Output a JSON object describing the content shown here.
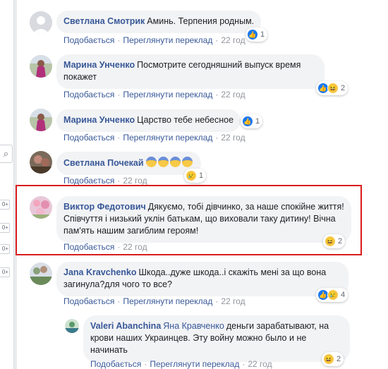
{
  "comments": [
    {
      "author": "Светлана Смотрик",
      "text": "Аминь. Терпения родным.",
      "like": "Подобається",
      "translate": "Переглянути переклад",
      "time": "22 год",
      "reaction_count": "1"
    },
    {
      "author": "Марина Унченко",
      "text": "Посмотрите сегодняшний выпуск время покажет",
      "like": "Подобається",
      "translate": "Переглянути переклад",
      "time": "22 год",
      "reaction_count": "2"
    },
    {
      "author": "Марина Унченко",
      "text": "Царство тебе небесное",
      "like": "Подобається",
      "translate": "Переглянути переклад",
      "time": "22 год",
      "reaction_count": "1"
    },
    {
      "author": "Светлана Почекай",
      "text": "",
      "like": "Подобається",
      "time": "22 год",
      "reaction_count": "1"
    },
    {
      "author": "Виктор Федотович",
      "text": "Дякуємо, тобі дівчинко, за наше спокійне життя! Співчуття і низький уклін батькам, що виховали таку дитину! Вічна пам'ять нашим загиблим героям!",
      "like": "Подобається",
      "time": "22 год",
      "reaction_count": "2"
    },
    {
      "author": "Jana Kravchenko",
      "text": "Шкода..дуже шкода..і скажіть мені за що вона загинула?для чого то все?",
      "like": "Подобається",
      "translate": "Переглянути переклад",
      "time": "22 год",
      "reaction_count": "4"
    }
  ],
  "reply": {
    "author": "Valeri Abanchina",
    "reply_to": "Яна Кравченко",
    "text": "деньги зарабатывают, на крови наших Украинцев. Эту войну можно было и не начинать",
    "like": "Подобається",
    "translate": "Переглянути переклад",
    "time": "22 год",
    "reaction_count": "2"
  },
  "sidebar": {
    "search_icon": "search-icon",
    "badges": [
      "0+",
      "0+",
      "0+",
      "0+"
    ]
  },
  "colors": {
    "link": "#385898",
    "highlight": "#d91c1c",
    "bubble": "#f2f3f5"
  }
}
